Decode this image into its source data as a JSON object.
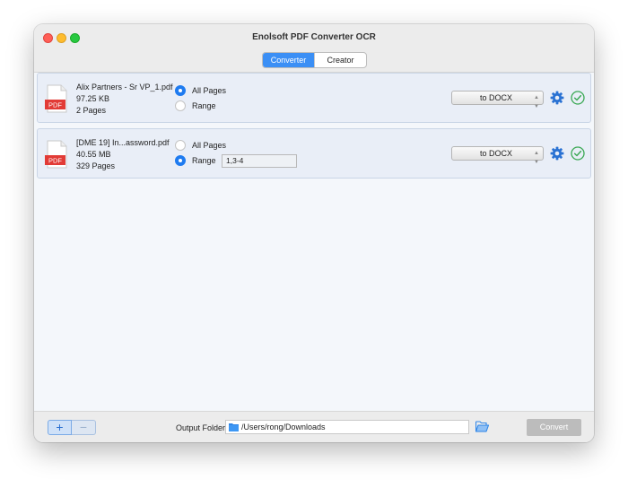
{
  "window": {
    "title": "Enolsoft PDF Converter OCR"
  },
  "tabs": [
    {
      "label": "Converter",
      "active": true
    },
    {
      "label": "Creator",
      "active": false
    }
  ],
  "files": [
    {
      "icon_label": "PDF",
      "name": "Alix Partners - Sr VP_1.pdf",
      "size": "97.25 KB",
      "pages": "2 Pages",
      "all_pages_label": "All Pages",
      "range_label": "Range",
      "selected_option": "All Pages",
      "range_value": "",
      "format": "to DOCX"
    },
    {
      "icon_label": "PDF",
      "name": "[DME 19] In...assword.pdf",
      "size": "40.55 MB",
      "pages": "329 Pages",
      "all_pages_label": "All Pages",
      "range_label": "Range",
      "selected_option": "Range",
      "range_value": "1,3-4",
      "format": "to DOCX"
    }
  ],
  "bottom": {
    "add_label": "+",
    "remove_label": "−",
    "output_label": "Output Folder",
    "output_path": "/Users/rong/Downloads",
    "convert_label": "Convert"
  },
  "colors": {
    "accent": "#1e7bf0",
    "tab_active": "#3b8ff5",
    "pdf_red": "#e23b36",
    "check_green": "#3aa853",
    "gear_blue": "#2a72d3"
  },
  "icons": [
    "pdf-icon",
    "gear-icon",
    "checkmark-icon",
    "folder-icon",
    "open-folder-icon"
  ]
}
